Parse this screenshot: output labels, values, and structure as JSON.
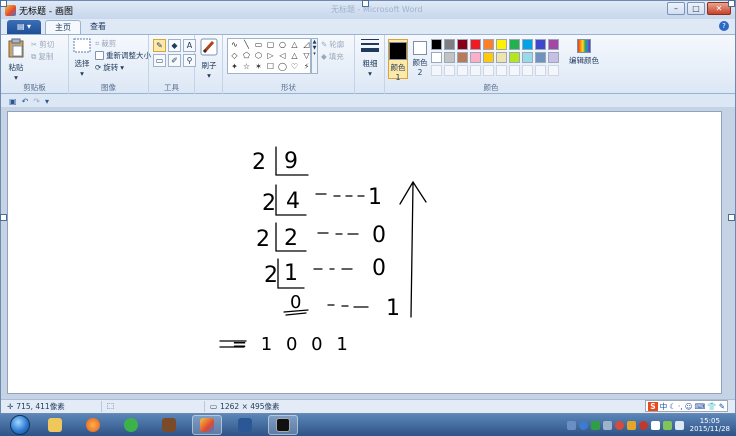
{
  "window": {
    "title": "无标题 - 画图",
    "ghost_title": "无标题 - Microsoft Word",
    "controls": [
      "–",
      "□",
      "✕"
    ]
  },
  "ribbon_tabs": {
    "file_label": "▤ ▾",
    "tabs": [
      "主页",
      "查看"
    ],
    "active": "主页"
  },
  "clipboard": {
    "paste": "粘贴",
    "cut": "剪切",
    "copy": "复制",
    "label": "剪贴板"
  },
  "image": {
    "select": "选择",
    "crop": "裁剪",
    "resize": "重新调整大小",
    "rotate": "旋转",
    "label": "图像"
  },
  "tools": {
    "label": "工具",
    "icons": [
      "pencil-icon",
      "fill-icon",
      "text-icon",
      "eraser-icon",
      "color-picker-icon",
      "magnifier-icon"
    ],
    "glyphs": [
      "✎",
      "◆",
      "A",
      "▭",
      "✐",
      "⚲"
    ]
  },
  "brushes": {
    "label": "刷子"
  },
  "shapes": {
    "label": "形状",
    "outline": "轮廓",
    "fill": "填充",
    "glyphs": [
      "∿",
      "╲",
      "▭",
      "▢",
      "○",
      "△",
      "◿",
      "◇",
      "⬠",
      "⬡",
      "▷",
      "◁",
      "△",
      "▽",
      "✦",
      "☆",
      "✶",
      "☐",
      "◯",
      "♡",
      "⚡"
    ]
  },
  "size": {
    "label": "粗细"
  },
  "colors": {
    "color1": "颜色 1",
    "color2": "颜色 2",
    "color1_value": "#000000",
    "color2_value": "#ffffff",
    "edit": "编辑颜色",
    "label": "颜色",
    "palette": [
      "#000000",
      "#7f7f7f",
      "#880015",
      "#ed1c24",
      "#ff7f27",
      "#fff200",
      "#22b14c",
      "#00a2e8",
      "#3f48cc",
      "#a349a4",
      "#ffffff",
      "#c3c3c3",
      "#b97a57",
      "#ffaec9",
      "#ffc90e",
      "#efe4b0",
      "#b5e61d",
      "#99d9ea",
      "#7092be",
      "#c8bfe7",
      "",
      "",
      "",
      "",
      "",
      "",
      "",
      "",
      "",
      ""
    ]
  },
  "status": {
    "cursor": "715, 411像素",
    "dimensions": "1262 × 495像素"
  },
  "drawing": {
    "rows": [
      {
        "left": "2",
        "right": "9",
        "rem": ""
      },
      {
        "left": "2",
        "right": "4",
        "rem": "1"
      },
      {
        "left": "2",
        "right": "2",
        "rem": "0"
      },
      {
        "left": "2",
        "right": "1",
        "rem": "0"
      },
      {
        "left": "",
        "right": "0",
        "rem": "1"
      }
    ],
    "result": "= 1 0 0 1"
  },
  "ime": {
    "logo": "S",
    "mode": "中",
    "punct": "·,"
  },
  "clock": {
    "time": "15:05",
    "date": "2015/11/28"
  },
  "taskbar": {
    "apps": [
      "explorer",
      "firefox",
      "wechat",
      "game",
      "paint",
      "word",
      "terminal"
    ]
  }
}
